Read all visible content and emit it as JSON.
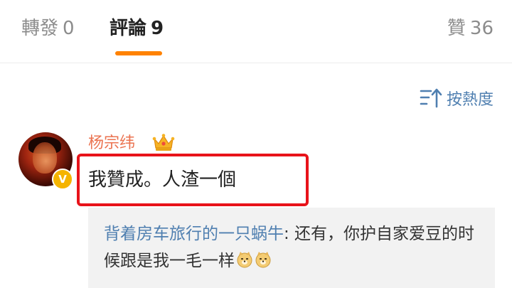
{
  "tabs": {
    "reposts": {
      "label": "轉發",
      "count": "0"
    },
    "comments": {
      "label": "評論",
      "count": "9"
    },
    "likes": {
      "label": "贊",
      "count": "36"
    }
  },
  "sort": {
    "label": "按熱度",
    "icon": "sort-icon"
  },
  "comment": {
    "username": "杨宗纬",
    "badge_icon": "crown-icon",
    "verified_icon": "verified-v-icon",
    "text": "我贊成。人渣一個",
    "highlight_color": "#e8131a"
  },
  "reply": {
    "author": "背着房车旅行的一只蜗牛",
    "separator": ":",
    "text": " 还有，你护自家爱豆的时候跟是我一毛一样",
    "emoji": [
      "doge-emoji",
      "doge-emoji"
    ]
  },
  "colors": {
    "accent": "#ff8200",
    "link": "#4f7fb0",
    "username": "#eb7350",
    "verified": "#f5b400"
  }
}
